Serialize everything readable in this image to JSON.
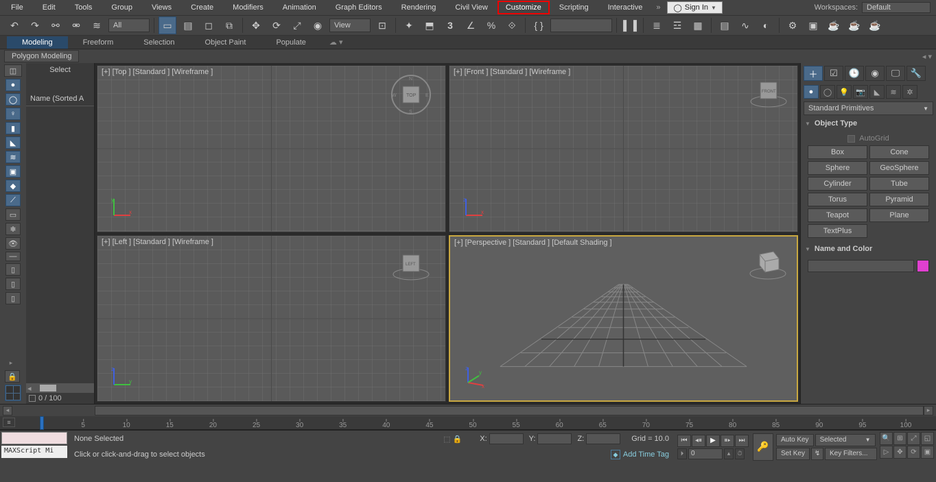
{
  "menu": {
    "items": [
      "File",
      "Edit",
      "Tools",
      "Group",
      "Views",
      "Create",
      "Modifiers",
      "Animation",
      "Graph Editors",
      "Rendering",
      "Civil View",
      "Customize",
      "Scripting",
      "Interactive"
    ],
    "highlighted_index": 11,
    "sign_in": "Sign In",
    "workspaces_label": "Workspaces:",
    "workspaces_value": "Default"
  },
  "toolbar": {
    "selset_dd": "All",
    "view_dd": "View",
    "snap_label": "3"
  },
  "ribbon": {
    "tabs": [
      "Modeling",
      "Freeform",
      "Selection",
      "Object Paint",
      "Populate"
    ],
    "active_tab": 0,
    "sub_button": "Polygon Modeling"
  },
  "scene": {
    "header_title": "Select",
    "column_header": "Name (Sorted A",
    "frame_text": "0 / 100"
  },
  "viewports": {
    "top": "[+] [Top ] [Standard ] [Wireframe ]",
    "front": "[+] [Front ] [Standard ] [Wireframe ]",
    "left": "[+] [Left ] [Standard ] [Wireframe ]",
    "persp": "[+] [Perspective ] [Standard ] [Default Shading ]",
    "cube_top": "TOP",
    "cube_front": "FRONT",
    "cube_left": "LEFT"
  },
  "cmd": {
    "category": "Standard Primitives",
    "roll_object_type": "Object Type",
    "autogrid": "AutoGrid",
    "prims": [
      "Box",
      "Cone",
      "Sphere",
      "GeoSphere",
      "Cylinder",
      "Tube",
      "Torus",
      "Pyramid",
      "Teapot",
      "Plane",
      "TextPlus"
    ],
    "roll_name_color": "Name and Color"
  },
  "status": {
    "script_text": "MAXScript Mi",
    "sel_text": "None Selected",
    "prompt": "Click or click-and-drag to select objects",
    "x": "X:",
    "y": "Y:",
    "z": "Z:",
    "grid": "Grid = 10.0",
    "add_tag": "Add Time Tag",
    "autokey": "Auto Key",
    "setkey": "Set Key",
    "keysel": "Selected",
    "keyfilters": "Key Filters...",
    "frame_value": "0"
  },
  "time": {
    "start": 0,
    "end": 100,
    "ticks": [
      5,
      10,
      15,
      20,
      25,
      30,
      35,
      40,
      45,
      50,
      55,
      60,
      65,
      70,
      75,
      80,
      85,
      90,
      95,
      100
    ]
  }
}
